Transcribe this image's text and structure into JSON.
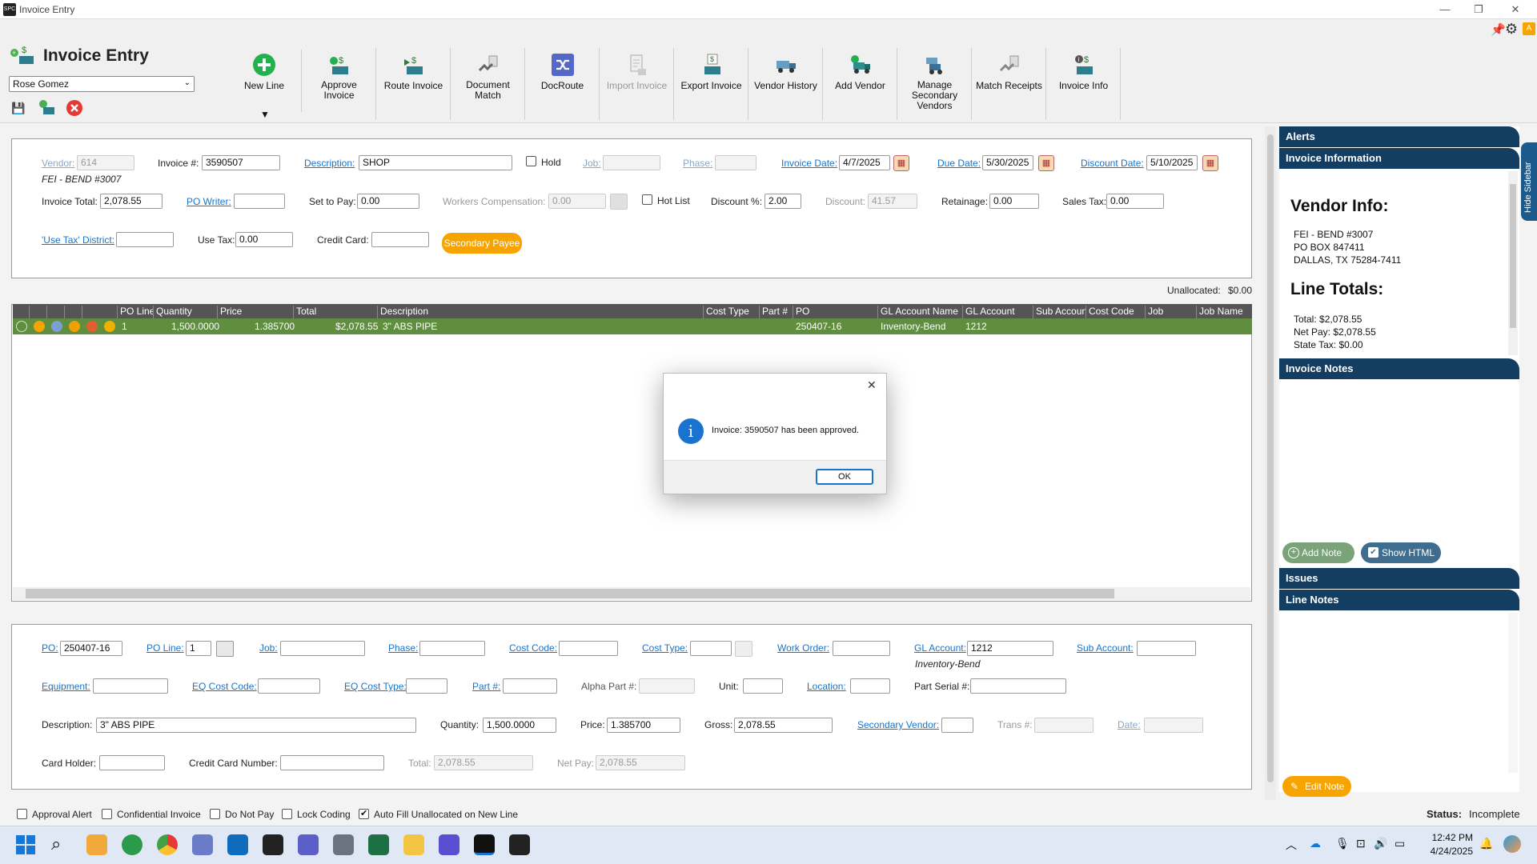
{
  "window": {
    "title": "Invoice Entry"
  },
  "app": {
    "title": "Invoice Entry",
    "user": "Rose Gomez"
  },
  "toolbar": {
    "new_line": "New Line",
    "approve_invoice": "Approve\nInvoice",
    "route_invoice": "Route Invoice",
    "document_match": "Document\nMatch",
    "docroute": "DocRoute",
    "import_invoice": "Import Invoice",
    "export_invoice": "Export Invoice",
    "vendor_history": "Vendor History",
    "add_vendor": "Add Vendor",
    "manage_secondary_vendors": "Manage\nSecondary\nVendors",
    "match_receipts": "Match Receipts",
    "invoice_info": "Invoice Info",
    "dropdown_arrow": "▼"
  },
  "header": {
    "vendor_label": "Vendor:",
    "vendor_value": "614",
    "vendor_name": "FEI - BEND #3007",
    "invoice_no_label": "Invoice #:",
    "invoice_no_value": "3590507",
    "description_label": "Description:",
    "description_value": "SHOP",
    "hold_label": "Hold",
    "job_label": "Job:",
    "job_value": "",
    "phase_label": "Phase:",
    "phase_value": "",
    "invoice_date_label": "Invoice Date:",
    "invoice_date_value": "4/7/2025",
    "due_date_label": "Due Date:",
    "due_date_value": "5/30/2025",
    "discount_date_label": "Discount Date:",
    "discount_date_value": "5/10/2025",
    "invoice_total_label": "Invoice Total:",
    "invoice_total_value": "2,078.55",
    "po_writer_label": "PO Writer:",
    "po_writer_value": "",
    "set_to_pay_label": "Set to Pay:",
    "set_to_pay_value": "0.00",
    "workers_comp_label": "Workers Compensation:",
    "workers_comp_value": "0.00",
    "hot_list_label": "Hot List",
    "discount_pct_label": "Discount %:",
    "discount_pct_value": "2.00",
    "discount_label": "Discount:",
    "discount_value": "41.57",
    "retainage_label": "Retainage:",
    "retainage_value": "0.00",
    "sales_tax_label": "Sales Tax:",
    "sales_tax_value": "0.00",
    "use_tax_district_label": "'Use Tax' District:",
    "use_tax_district_value": "",
    "use_tax_label": "Use Tax:",
    "use_tax_value": "0.00",
    "credit_card_label": "Credit Card:",
    "credit_card_value": "",
    "secondary_payee": "Secondary Payee"
  },
  "unallocated": {
    "label": "Unallocated:",
    "value": "$0.00"
  },
  "grid": {
    "columns": [
      "PO Line",
      "Quantity",
      "Price",
      "Total",
      "Description",
      "Cost Type",
      "Part #",
      "PO",
      "GL Account Name",
      "GL Account",
      "Sub Account",
      "Cost Code",
      "Job",
      "Job Name"
    ],
    "row": {
      "po_line": "1",
      "quantity": "1,500.0000",
      "price": "1.385700",
      "total": "$2,078.55",
      "description": "3\" ABS PIPE",
      "po": "250407-16",
      "gl_account_name": "Inventory-Bend",
      "gl_account": "1212"
    }
  },
  "dialog": {
    "message": "Invoice: 3590507 has been approved.",
    "ok": "OK",
    "close": "✕",
    "info_glyph": "i"
  },
  "line": {
    "po_label": "PO:",
    "po_value": "250407-16",
    "po_line_label": "PO Line:",
    "po_line_value": "1",
    "job_label": "Job:",
    "phase_label": "Phase:",
    "cost_code_label": "Cost Code:",
    "cost_type_label": "Cost Type:",
    "work_order_label": "Work Order:",
    "gl_account_label": "GL Account:",
    "gl_account_value": "1212",
    "gl_account_name": "Inventory-Bend",
    "sub_account_label": "Sub Account:",
    "equipment_label": "Equipment:",
    "eq_cost_code_label": "EQ Cost Code:",
    "eq_cost_type_label": "EQ Cost Type:",
    "part_label": "Part #:",
    "alpha_part_label": "Alpha Part #:",
    "unit_label": "Unit:",
    "location_label": "Location:",
    "part_serial_label": "Part Serial #:",
    "description_label": "Description:",
    "description_value": "3\" ABS PIPE",
    "quantity_label": "Quantity:",
    "quantity_value": "1,500.0000",
    "price_label": "Price:",
    "price_value": "1.385700",
    "gross_label": "Gross:",
    "gross_value": "2,078.55",
    "secondary_vendor_label": "Secondary Vendor:",
    "trans_label": "Trans #:",
    "date_label": "Date:",
    "card_holder_label": "Card Holder:",
    "card_number_label": "Credit Card Number:",
    "total_label": "Total:",
    "total_value": "2,078.55",
    "net_pay_label": "Net Pay:",
    "net_pay_value": "2,078.55"
  },
  "footer": {
    "approval_alert": "Approval Alert",
    "confidential_invoice": "Confidential Invoice",
    "do_not_pay": "Do Not Pay",
    "lock_coding": "Lock Coding",
    "auto_fill": "Auto Fill Unallocated on New Line",
    "status_label": "Status:",
    "status_value": "Incomplete"
  },
  "sidebar": {
    "alerts": "Alerts",
    "invoice_information": "Invoice Information",
    "vendor_info_title": "Vendor Info:",
    "vendor_line1": "FEI - BEND #3007",
    "vendor_line2": "PO BOX 847411",
    "vendor_line3": "DALLAS, TX 75284-7411",
    "line_totals_title": "Line Totals:",
    "total_label": "Total:",
    "total_value": "$2,078.55",
    "net_pay_label": "Net Pay:",
    "net_pay_value": "$2,078.55",
    "state_tax_label": "State Tax:",
    "state_tax_value": "$0.00",
    "invoice_notes": "Invoice Notes",
    "add_note": "Add Note",
    "show_html": "Show HTML",
    "issues": "Issues",
    "line_notes": "Line Notes",
    "edit_note": "Edit Note",
    "hide_sidebar": "Hide Sidebar"
  },
  "clock": {
    "time": "12:42 PM",
    "date": "4/24/2025"
  },
  "colors": {
    "accent": "#143d62",
    "row_green": "#5e8e3e",
    "orange": "#f7a400",
    "link": "#1a73c8"
  }
}
